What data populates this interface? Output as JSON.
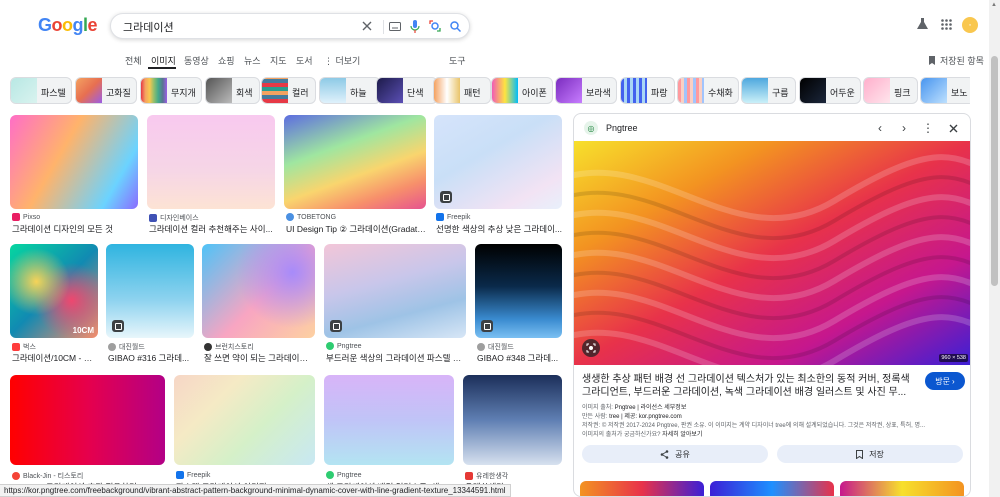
{
  "logo": {
    "text": "Google"
  },
  "search": {
    "query": "그라데이션"
  },
  "nav": {
    "tabs": [
      "전체",
      "이미지",
      "동영상",
      "쇼핑",
      "뉴스",
      "지도",
      "도서",
      "⋮ 더보기"
    ],
    "active_tab": "이미지",
    "tools": "도구",
    "saved": "저장된 항목"
  },
  "chips": [
    {
      "label": "파스텔"
    },
    {
      "label": "고화질"
    },
    {
      "label": "무지개"
    },
    {
      "label": "회색"
    },
    {
      "label": "컬러"
    },
    {
      "label": "하늘"
    },
    {
      "label": "단색"
    },
    {
      "label": "패턴"
    },
    {
      "label": "아이폰"
    },
    {
      "label": "보라색"
    },
    {
      "label": "파랑"
    },
    {
      "label": "수채화"
    },
    {
      "label": "구름"
    },
    {
      "label": "어두운"
    },
    {
      "label": "핑크"
    },
    {
      "label": "보노"
    }
  ],
  "results": [
    {
      "source": "Pixso",
      "caption": "그라데이션 디자인의 모든 것"
    },
    {
      "source": "디자인베이스",
      "caption": "그라데이션 컬러 추천해주는 사이..."
    },
    {
      "source": "TOBETONG",
      "caption": "UI Design Tip ② 그라데이션(Gradatio..."
    },
    {
      "source": "Freepik",
      "caption": "선명한 색상의 추상 낮은 그라데이..."
    },
    {
      "source": "벅스",
      "caption": "그라데이션/10CM - 벅스",
      "overlay": "10CM"
    },
    {
      "source": "대진월드",
      "caption": "GIBAO #316 그라데..."
    },
    {
      "source": "브런치스토리",
      "caption": "잘 쓰면 약이 되는 그라데이션 ..."
    },
    {
      "source": "Pngtree",
      "caption": "부드러운 색상의 그라데이션 파스텔 추..."
    },
    {
      "source": "대진월드",
      "caption": "GIBAO #348 그라데..."
    },
    {
      "source": "Black-Jin - 티스토리",
      "caption": "Android] 그라데이션 효과 적용하기"
    },
    {
      "source": "Freepik",
      "caption": "파스텔 그라데이션 이미지 - Freepik에..."
    },
    {
      "source": "Pngtree",
      "caption": "색 그라데이션 배경 일러스트, 색 그..."
    },
    {
      "source": "유레한생각",
      "caption": "유레한생각"
    }
  ],
  "panel": {
    "source": "Pngtree",
    "dimensions": "960 × 538",
    "title": "생생한 추상 패턴 배경 선 그라데이션 텍스처가 있는 최소한의 동적 커버, 정록색 그라디언트, 부드러운 그라데이션, 녹색 그라데이션 배경 일러스트 및 사진 무...",
    "visit_label": "방문",
    "image_credit_label": "이미지 출처:",
    "image_credit_value": "Pngtree | 라이선스 세부정보",
    "creator_label": "만든 사람:",
    "creator_value": "tree | 제공: kor.pngtree.com",
    "copyright_label": "저작권:",
    "copyright_value": "© 저작권 2017-2024 Pngtree, 판권 소유. 이 이미지는 계약 디자이너 tree에 의해 설계되었습니다. 그것은 저작권, 상표, 특허, 명...",
    "question": "이미지의 출처가 궁금하신가요?",
    "learn_more": "자세히 알아보기",
    "share_label": "공유",
    "save_label": "저장"
  },
  "status_url": "https://kor.pngtree.com/freebackground/vibrant-abstract-pattern-background-minimal-dynamic-cover-with-line-gradient-texture_13344591.html"
}
